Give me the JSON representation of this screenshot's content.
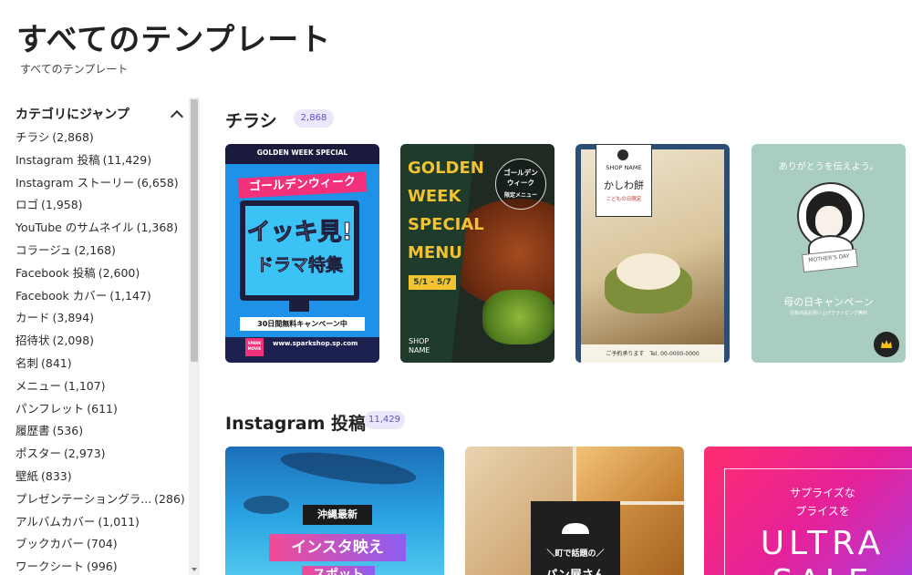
{
  "page": {
    "title": "すべてのテンプレート",
    "breadcrumb": "すべてのテンプレート"
  },
  "sidebar": {
    "header": "カテゴリにジャンプ",
    "items": [
      {
        "name": "チラシ",
        "count": "(2,868)"
      },
      {
        "name": "Instagram 投稿",
        "count": "(11,429)"
      },
      {
        "name": "Instagram ストーリー",
        "count": "(6,658)"
      },
      {
        "name": "ロゴ",
        "count": "(1,958)"
      },
      {
        "name": "YouTube のサムネイル",
        "count": "(1,368)"
      },
      {
        "name": "コラージュ",
        "count": "(2,168)"
      },
      {
        "name": "Facebook 投稿",
        "count": "(2,600)"
      },
      {
        "name": "Facebook カバー",
        "count": "(1,147)"
      },
      {
        "name": "カード",
        "count": "(3,894)"
      },
      {
        "name": "招待状",
        "count": "(2,098)"
      },
      {
        "name": "名刺",
        "count": "(841)"
      },
      {
        "name": "メニュー",
        "count": "(1,107)"
      },
      {
        "name": "パンフレット",
        "count": "(611)"
      },
      {
        "name": "履歴書",
        "count": "(536)"
      },
      {
        "name": "ポスター",
        "count": "(2,973)"
      },
      {
        "name": "壁紙",
        "count": "(833)"
      },
      {
        "name": "プレゼンテーショングラ...",
        "count": "(286)"
      },
      {
        "name": "アルバムカバー",
        "count": "(1,011)"
      },
      {
        "name": "ブックカバー",
        "count": "(704)"
      },
      {
        "name": "ワークシート",
        "count": "(996)"
      }
    ]
  },
  "sections": [
    {
      "title": "チラシ",
      "badge": "2,868",
      "cards": [
        {
          "top": "GOLDEN WEEK SPECIAL",
          "banner": "ゴールデンウィーク",
          "headline": "イッキ見!",
          "sub": "ドラマ特集",
          "strip": "30日間無料キャンペーン中",
          "logo1": "SPARK",
          "logo2": "MOVIE",
          "url": "www.sparkshop.sp.com"
        },
        {
          "l1": "GOLDEN",
          "l2": "WEEK",
          "l3": "SPECIAL",
          "l4": "MENU",
          "dates": "5/1 - 5/7",
          "stamp1": "ゴールデン",
          "stamp2": "ウィーク",
          "stamp3": "限定メニュー",
          "shop1": "SHOP",
          "shop2": "NAME"
        },
        {
          "shop": "SHOP NAME",
          "title": "かしわ餅",
          "sub": "こどもの日限定",
          "footer": "ご予約承ります　Tel. 00-0000-0000"
        },
        {
          "top": "ありがとうを伝えよう。",
          "ribbon": "MOTHER'S DAY",
          "headline": "母の日キャンペーン",
          "sub": "対象商品お買い上げでラッピング無料"
        }
      ]
    },
    {
      "title": "Instagram 投稿",
      "badge": "11,429",
      "cards": [
        {
          "l1": "沖縄最新",
          "l2": "インスタ映え",
          "l3": "スポット"
        },
        {
          "l1": "＼町で話題の／",
          "l2": "パン屋さん"
        },
        {
          "l1": "サプライズな",
          "l2": "プライスを",
          "l3": "ULTRA",
          "l4": "SALE"
        }
      ]
    }
  ],
  "colors": {
    "accent": "#5b52c8",
    "badge_bg": "#e9e7f9",
    "crown": "#f4c21b"
  }
}
